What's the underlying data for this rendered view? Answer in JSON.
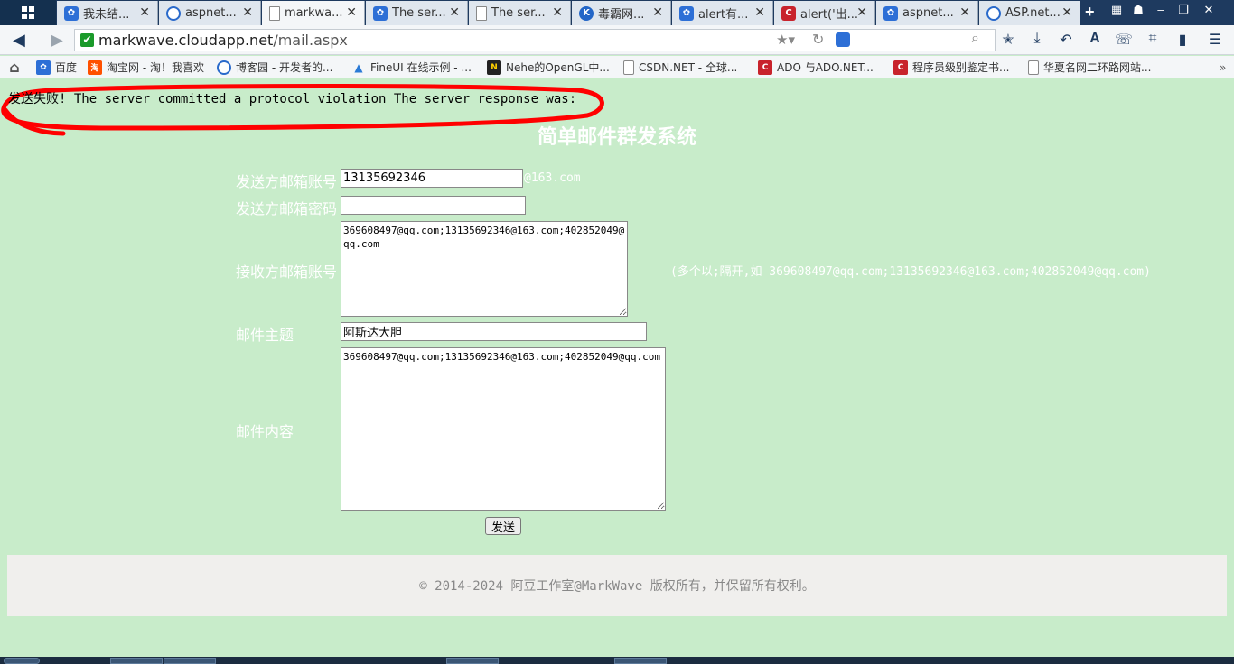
{
  "browser": {
    "tabs": [
      {
        "label": "我未结...",
        "icon": "baidu-paw-icon"
      },
      {
        "label": "aspnet...",
        "icon": "cnblogs-icon"
      },
      {
        "label": "markwa...",
        "icon": "page-icon",
        "active": true
      },
      {
        "label": "The ser...",
        "icon": "baidu-paw-icon"
      },
      {
        "label": "The ser...",
        "icon": "page-icon"
      },
      {
        "label": "毒霸网...",
        "icon": "kingsoft-icon"
      },
      {
        "label": "alert有...",
        "icon": "baidu-paw-icon"
      },
      {
        "label": "alert('出...",
        "icon": "csdn-icon"
      },
      {
        "label": "aspnet...",
        "icon": "baidu-paw-icon"
      },
      {
        "label": "ASP.net...",
        "icon": "cnblogs-icon"
      }
    ],
    "address": {
      "host": "markwave.cloudapp.net",
      "path": "/mail.aspx"
    },
    "bookmarks": [
      {
        "label": "百度",
        "icon": "baidu-paw-icon"
      },
      {
        "label": "淘宝网 - 淘！我喜欢",
        "icon": "taobao-icon"
      },
      {
        "label": "博客园 - 开发者的...",
        "icon": "cnblogs-icon"
      },
      {
        "label": "FineUI 在线示例 - ...",
        "icon": "fineui-icon"
      },
      {
        "label": "Nehe的OpenGL中...",
        "icon": "nehe-icon"
      },
      {
        "label": "CSDN.NET - 全球...",
        "icon": "page-icon"
      },
      {
        "label": "ADO 与ADO.NET...",
        "icon": "csdn-icon"
      },
      {
        "label": "程序员级别鉴定书...",
        "icon": "csdn-icon"
      },
      {
        "label": "华夏名网二环路网站...",
        "icon": "page-icon"
      }
    ]
  },
  "page": {
    "error_message": "发送失败! The server committed a protocol violation The server response was:",
    "title": "简单邮件群发系统",
    "form": {
      "sender_label": "发送方邮箱账号",
      "sender_value": "13135692346",
      "sender_suffix": "@163.com",
      "password_label": "发送方邮箱密码",
      "password_value": "",
      "recipients_label": "接收方邮箱账号",
      "recipients_value": "369608497@qq.com;13135692346@163.com;402852049@qq.com",
      "recipients_hint": "(多个以;隔开,如 369608497@qq.com;13135692346@163.com;402852049@qq.com)",
      "subject_label": "邮件主题",
      "subject_value": "阿斯达大胆",
      "body_label": "邮件内容",
      "body_value": "369608497@qq.com;13135692346@163.com;402852049@qq.com",
      "send_label": "发送"
    },
    "footer": "© 2014-2024 阿豆工作室@MarkWave 版权所有，并保留所有权利。"
  },
  "colors": {
    "page_bg": "#c8ecca",
    "annotation": "#ff0000",
    "label_text": "#ffffff"
  }
}
